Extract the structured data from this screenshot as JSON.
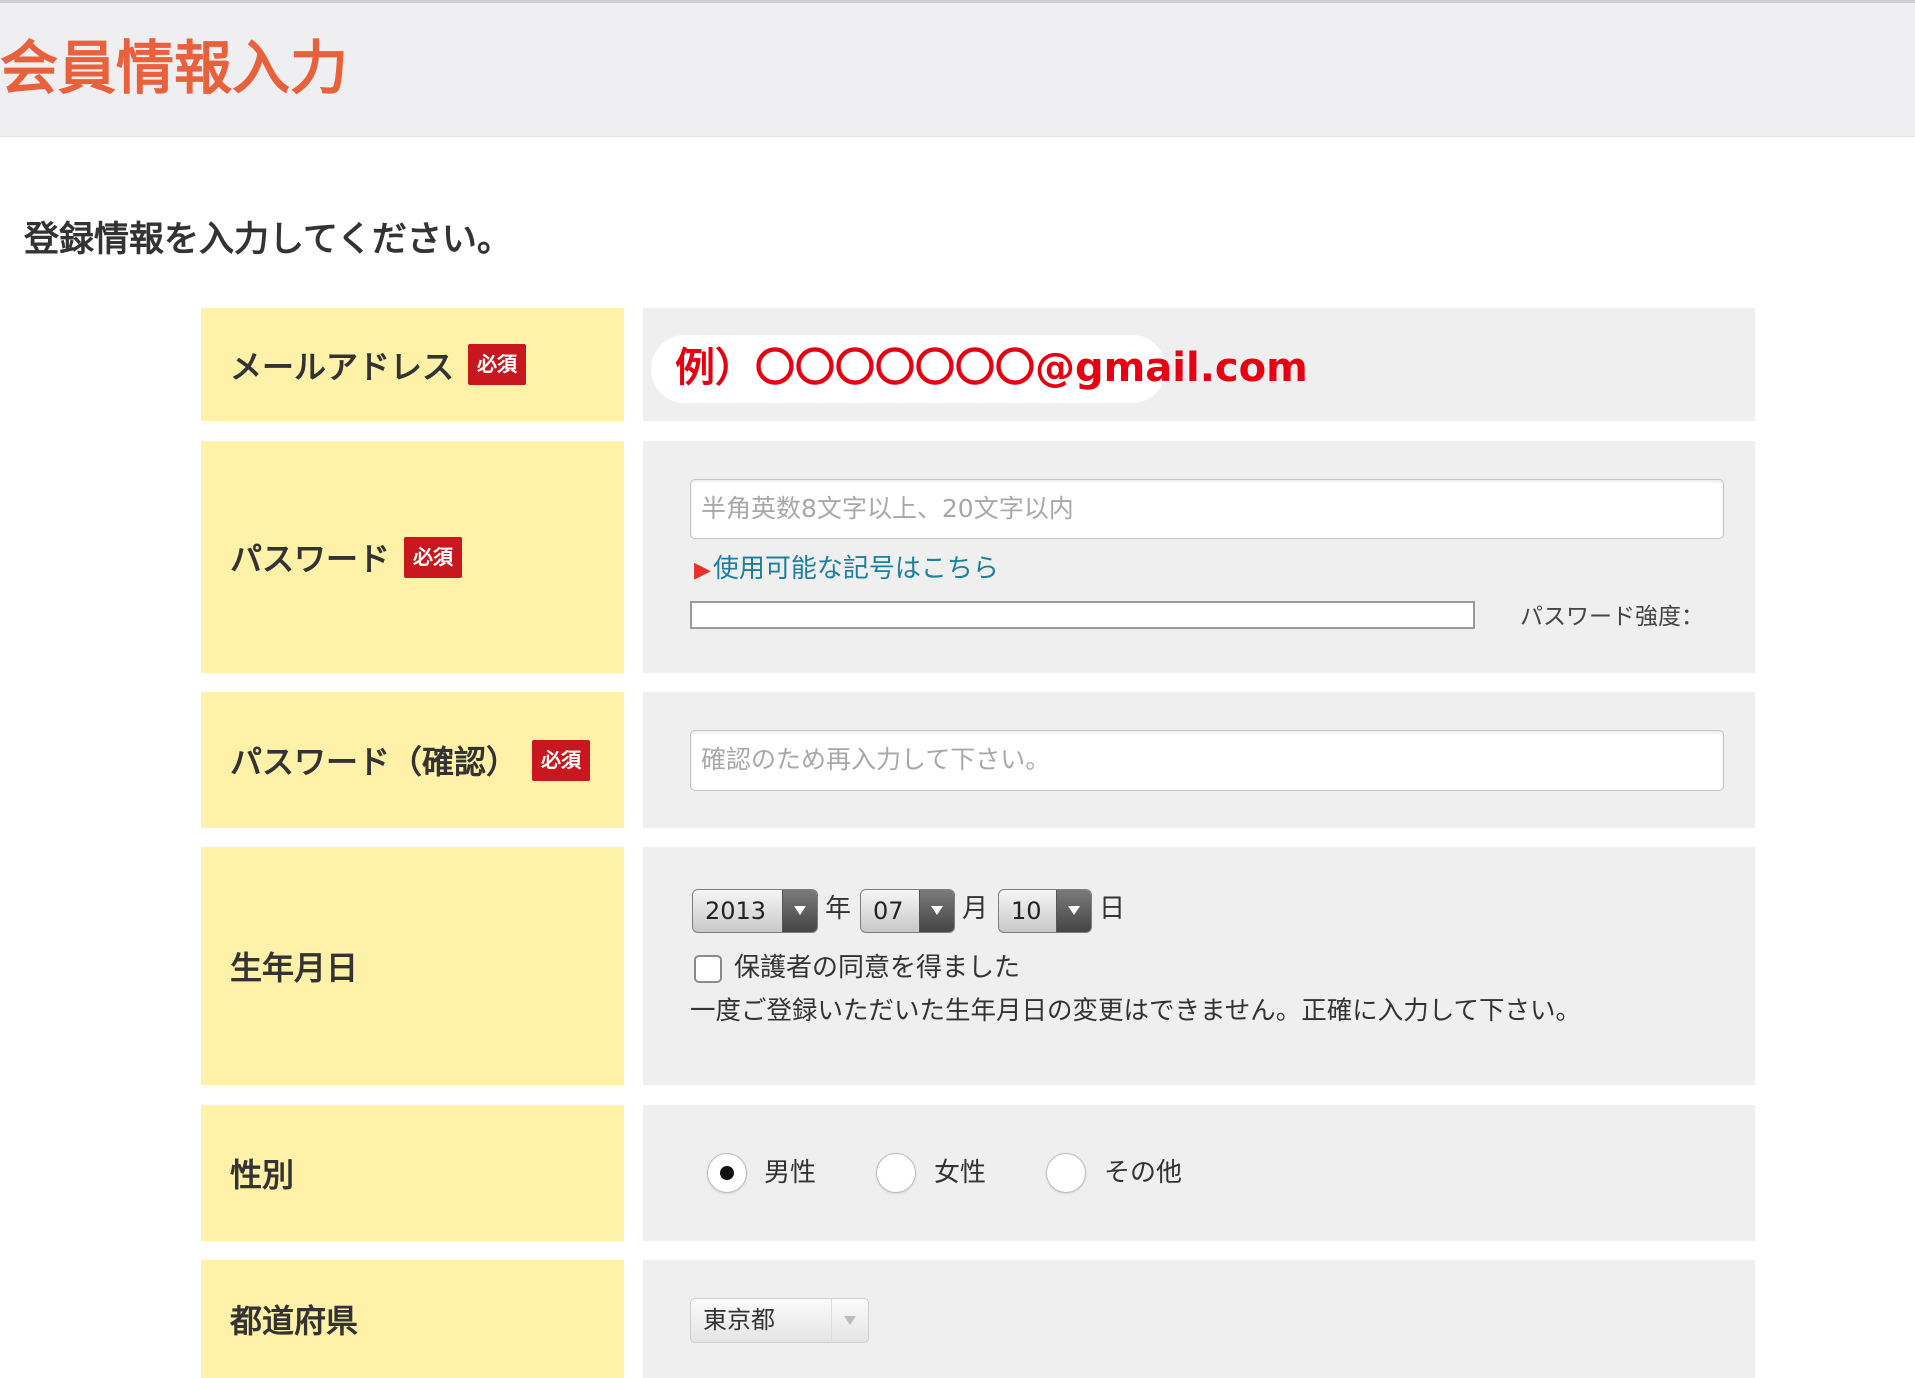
{
  "header": {
    "title": "会員情報入力"
  },
  "intro": "登録情報を入力してください。",
  "required_badge": "必須",
  "email": {
    "label": "メールアドレス",
    "example": "例）〇〇〇〇〇〇〇@gmail.com"
  },
  "password": {
    "label": "パスワード",
    "placeholder": "半角英数8文字以上、20文字以内",
    "symbols_link": "使用可能な記号はこちら",
    "strength_label": "パスワード強度：",
    "strength": 0
  },
  "password_confirm": {
    "label": "パスワード（確認）",
    "placeholder": "確認のため再入力して下さい。"
  },
  "birthdate": {
    "label": "生年月日",
    "year": "2013",
    "year_unit": "年",
    "month": "07",
    "month_unit": "月",
    "day": "10",
    "day_unit": "日",
    "guardian_consent_label": "保護者の同意を得ました",
    "guardian_consent_checked": false,
    "note": "一度ご登録いただいた生年月日の変更はできません。正確に入力して下さい。"
  },
  "gender": {
    "label": "性別",
    "options": [
      {
        "label": "男性",
        "selected": true
      },
      {
        "label": "女性",
        "selected": false
      },
      {
        "label": "その他",
        "selected": false
      }
    ]
  },
  "prefecture": {
    "label": "都道府県",
    "value": "東京都"
  },
  "icons": {
    "link_marker": "triangle-right-icon",
    "select_arrow": "dropdown-arrow-icon"
  },
  "colors": {
    "title": "#e8603c",
    "label_background": "#fff2a8",
    "field_background": "#efefef",
    "required_badge": "#c8171e",
    "example_text": "#e60012",
    "link": "#1b7f9e"
  }
}
